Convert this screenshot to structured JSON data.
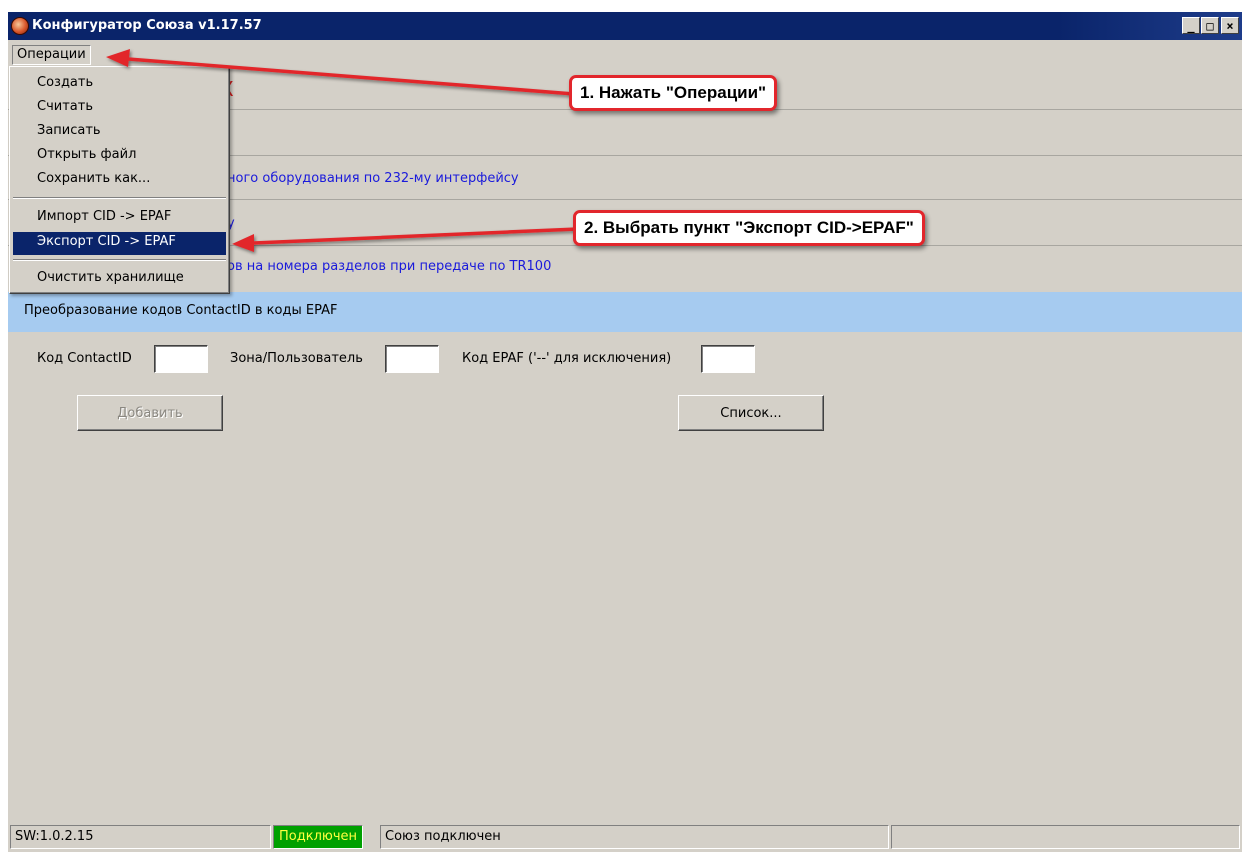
{
  "window": {
    "title": "Конфигуратор Союза v1.17.57",
    "minimize_glyph": "_",
    "maximize_glyph": "□",
    "close_glyph": "×"
  },
  "menubar": {
    "operations_label": "Операции"
  },
  "operations_menu": {
    "items": [
      {
        "label": "Создать"
      },
      {
        "label": "Считать"
      },
      {
        "label": "Записать"
      },
      {
        "label": "Открыть файл"
      },
      {
        "label": "Сохранить как..."
      },
      {
        "label": "Импорт CID -> EPAF"
      },
      {
        "label": "Экспорт CID -> EPAF",
        "selected": true
      },
      {
        "label": "Очистить хранилище"
      }
    ]
  },
  "background_rows": {
    "partial_red_x": "X",
    "row3_text": "ного оборудования по 232-му интерфейсу",
    "row4_text": "у",
    "row5_text": "ов на номера разделов при передаче по TR100"
  },
  "section": {
    "header": "Преобразование кодов ContactID в коды EPAF",
    "contact_id_label": "Код ContactID",
    "contact_id_value": "",
    "zone_user_label": "Зона/Пользователь",
    "zone_user_value": "",
    "epaf_label": "Код EPAF ('--' для исключения)",
    "epaf_value": "",
    "add_button": "Добавить",
    "list_button": "Список..."
  },
  "statusbar": {
    "sw_version": "SW:1.0.2.15",
    "connection_status": "Подключен",
    "connection_message": "Союз подключен",
    "status_color": "#00a000"
  },
  "annotations": {
    "step1": "1. Нажать \"Операции\"",
    "step2": "2. Выбрать пункт \"Экспорт CID->EPAF\"",
    "arrow_color": "#e2262c"
  }
}
